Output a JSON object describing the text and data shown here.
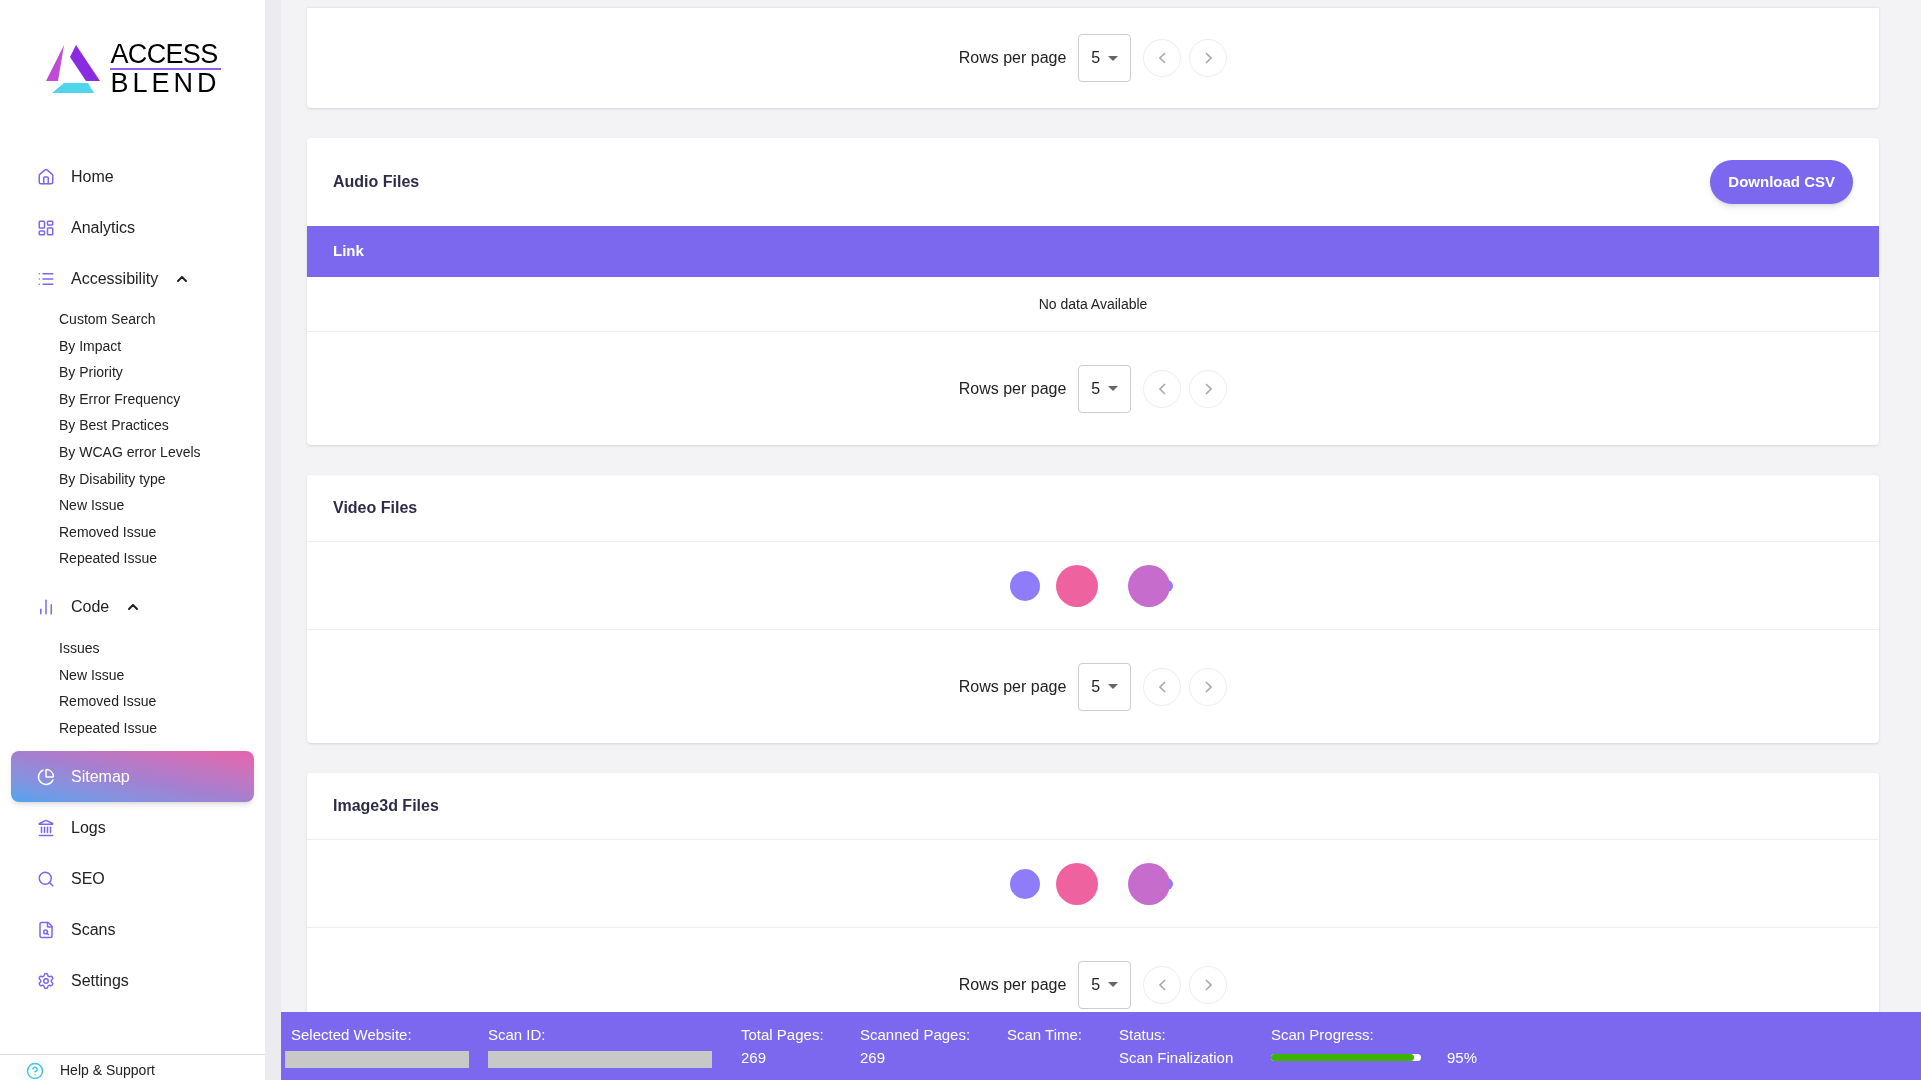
{
  "logo": {
    "line_1": "ACCESS",
    "line_2": "BLEND"
  },
  "sidebar": {
    "items": [
      {
        "kind": "link",
        "label": "Home",
        "selected": false
      },
      {
        "kind": "link",
        "label": "Analytics",
        "selected": false
      },
      {
        "kind": "group",
        "label": "Accessibility",
        "expanded": true,
        "children": [
          {
            "label": "Custom Search"
          },
          {
            "label": "By Impact"
          },
          {
            "label": "By Priority"
          },
          {
            "label": "By Error Frequency"
          },
          {
            "label": "By Best Practices"
          },
          {
            "label": "By WCAG error Levels"
          },
          {
            "label": "By Disability type"
          },
          {
            "label": "New Issue"
          },
          {
            "label": "Removed Issue"
          },
          {
            "label": "Repeated Issue"
          }
        ]
      },
      {
        "kind": "group",
        "label": "Code",
        "expanded": true,
        "children": [
          {
            "label": "Issues"
          },
          {
            "label": "New Issue"
          },
          {
            "label": "Removed Issue"
          },
          {
            "label": "Repeated Issue"
          }
        ]
      },
      {
        "kind": "link",
        "label": "Sitemap",
        "selected": true
      },
      {
        "kind": "link",
        "label": "Logs",
        "selected": false
      },
      {
        "kind": "link",
        "label": "SEO",
        "selected": false
      },
      {
        "kind": "link",
        "label": "Scans",
        "selected": false
      },
      {
        "kind": "link",
        "label": "Settings",
        "selected": false
      }
    ],
    "footer": {
      "label": "Help & Support"
    }
  },
  "cards": [
    {
      "kind": "partial",
      "pagination": {
        "label": "Rows per page",
        "rows": "5"
      }
    },
    {
      "kind": "table",
      "title": "Audio Files",
      "button": "Download CSV",
      "columns": [
        "Link"
      ],
      "empty": "No data Available",
      "pagination": {
        "label": "Rows per page",
        "rows": "5"
      }
    },
    {
      "kind": "loading",
      "title": "Video Files",
      "pagination": {
        "label": "Rows per page",
        "rows": "5"
      }
    },
    {
      "kind": "loading",
      "title": "Image3d Files",
      "pagination": {
        "label": "Rows per page",
        "rows": "5"
      }
    }
  ],
  "status_bar": {
    "selected_website": "Selected Website:",
    "scan_id": "Scan ID:",
    "total_pages": {
      "label": "Total Pages:",
      "value": "269"
    },
    "scanned_pages": {
      "label": "Scanned Pages:",
      "value": "269"
    },
    "scan_time": {
      "label": "Scan Time:"
    },
    "status": {
      "label": "Status:",
      "value": "Scan Finalization"
    },
    "scan_progress": {
      "label": "Scan Progress:",
      "level": 0.95,
      "reading": "95%"
    }
  }
}
